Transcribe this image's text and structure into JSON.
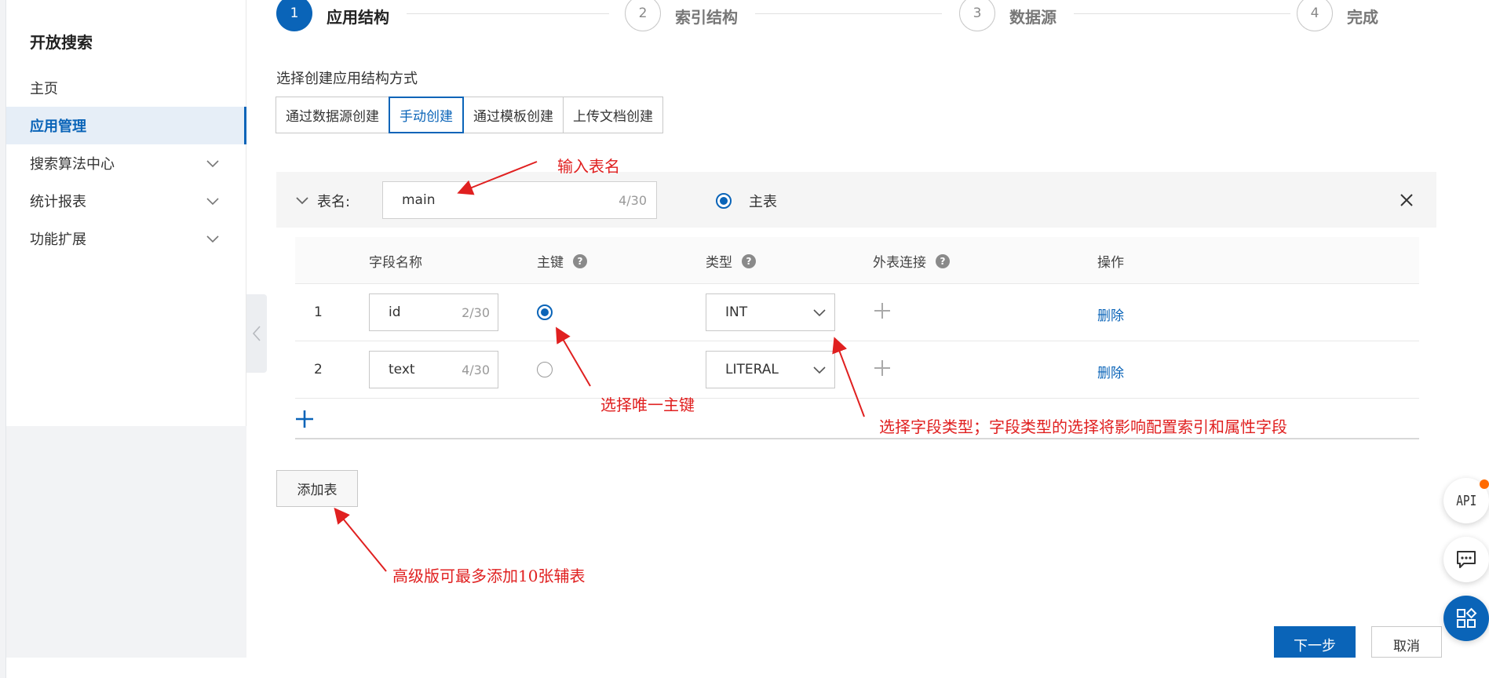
{
  "sidebar": {
    "title": "开放搜索",
    "items": [
      {
        "label": "主页",
        "active": false,
        "expandable": false
      },
      {
        "label": "应用管理",
        "active": true,
        "expandable": false
      },
      {
        "label": "搜索算法中心",
        "active": false,
        "expandable": true
      },
      {
        "label": "统计报表",
        "active": false,
        "expandable": true
      },
      {
        "label": "功能扩展",
        "active": false,
        "expandable": true
      }
    ]
  },
  "steps": [
    {
      "num": "1",
      "label": "应用结构",
      "active": true
    },
    {
      "num": "2",
      "label": "索引结构",
      "active": false
    },
    {
      "num": "3",
      "label": "数据源",
      "active": false
    },
    {
      "num": "4",
      "label": "完成",
      "active": false
    }
  ],
  "create_method": {
    "title": "选择创建应用结构方式",
    "options": [
      "通过数据源创建",
      "手动创建",
      "通过模板创建",
      "上传文档创建"
    ],
    "selected": "手动创建"
  },
  "table": {
    "name_label": "表名:",
    "name_value": "main",
    "name_count": "4/30",
    "primary_label": "主表",
    "primary_selected": true,
    "columns": {
      "field_name": "字段名称",
      "primary_key": "主键",
      "type": "类型",
      "foreign_join": "外表连接",
      "action": "操作"
    },
    "rows": [
      {
        "index": "1",
        "name": "id",
        "count": "2/30",
        "primary": true,
        "type": "INT",
        "action": "删除"
      },
      {
        "index": "2",
        "name": "text",
        "count": "4/30",
        "primary": false,
        "type": "LITERAL",
        "action": "删除"
      }
    ]
  },
  "add_table_label": "添加表",
  "footer": {
    "next_label": "下一步",
    "cancel_label": "取消"
  },
  "floating": {
    "api_label": "API"
  },
  "annotations": {
    "table_name": "输入表名",
    "primary_key": "选择唯一主键",
    "field_type": "选择字段类型；字段类型的选择将影响配置索引和属性字段",
    "add_table": "高级版可最多添加10张辅表"
  },
  "colors": {
    "accent": "#0a64b8",
    "annotation": "#e02020",
    "badge": "#ff6a00"
  }
}
